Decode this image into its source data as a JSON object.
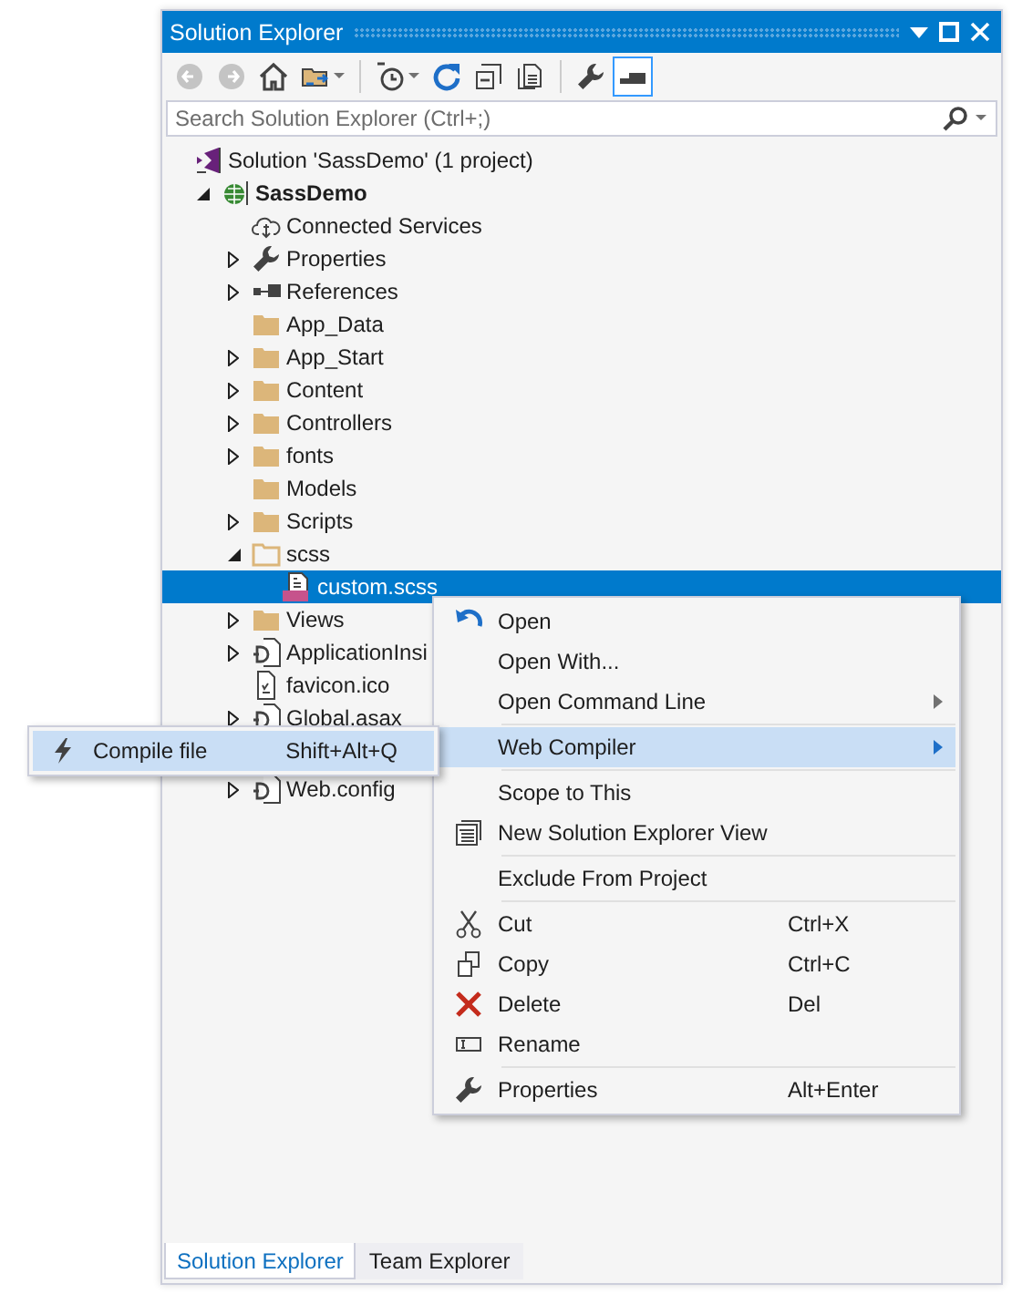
{
  "window": {
    "title": "Solution Explorer"
  },
  "toolbar": [
    {
      "kind": "back",
      "disabled": true,
      "pressed": false,
      "dropdown": false
    },
    {
      "kind": "forward",
      "disabled": true,
      "pressed": false,
      "dropdown": false
    },
    {
      "kind": "home",
      "disabled": false,
      "pressed": false,
      "dropdown": false
    },
    {
      "kind": "sync",
      "disabled": false,
      "pressed": false,
      "dropdown": true
    },
    {
      "kind": "separator"
    },
    {
      "kind": "history",
      "disabled": false,
      "pressed": false,
      "dropdown": true
    },
    {
      "kind": "refresh",
      "disabled": false,
      "pressed": false,
      "dropdown": false
    },
    {
      "kind": "collapse",
      "disabled": false,
      "pressed": false,
      "dropdown": false
    },
    {
      "kind": "allfiles",
      "disabled": false,
      "pressed": false,
      "dropdown": false
    },
    {
      "kind": "separator"
    },
    {
      "kind": "properties",
      "disabled": false,
      "pressed": false,
      "dropdown": false
    },
    {
      "kind": "preview",
      "disabled": false,
      "pressed": true,
      "dropdown": false
    }
  ],
  "search": {
    "placeholder": "Search Solution Explorer (Ctrl+;)"
  },
  "tree": {
    "items": [
      {
        "kind": "solution",
        "label": "Solution 'SassDemo' (1 project)",
        "selected": false,
        "children": [
          {
            "kind": "project",
            "label": "SassDemo",
            "selected": false,
            "expanded": true,
            "children": [
              {
                "kind": "cloud",
                "label": "Connected Services",
                "selected": false
              },
              {
                "kind": "wrench",
                "label": "Properties",
                "selected": false,
                "expanded": false
              },
              {
                "kind": "references",
                "label": "References",
                "selected": false,
                "expanded": false
              },
              {
                "kind": "folder",
                "label": "App_Data",
                "selected": false
              },
              {
                "kind": "folder",
                "label": "App_Start",
                "selected": false,
                "expanded": false
              },
              {
                "kind": "folder",
                "label": "Content",
                "selected": false,
                "expanded": false
              },
              {
                "kind": "folder",
                "label": "Controllers",
                "selected": false,
                "expanded": false
              },
              {
                "kind": "folder",
                "label": "fonts",
                "selected": false,
                "expanded": false
              },
              {
                "kind": "folder",
                "label": "Models",
                "selected": false
              },
              {
                "kind": "folder",
                "label": "Scripts",
                "selected": false,
                "expanded": false
              },
              {
                "kind": "folder-open",
                "label": "scss",
                "selected": false,
                "expanded": true,
                "children": [
                  {
                    "kind": "sass",
                    "label": "custom.scss",
                    "selected": true
                  }
                ]
              },
              {
                "kind": "folder",
                "label": "Views",
                "selected": false,
                "expanded": false
              },
              {
                "kind": "config",
                "label": "ApplicationInsi",
                "selected": false,
                "expanded": false
              },
              {
                "kind": "file",
                "label": "favicon.ico",
                "selected": false
              },
              {
                "kind": "config",
                "label": "Global.asax",
                "selected": false,
                "expanded": false
              },
              {
                "kind": "config",
                "label": "Web.config",
                "selected": false,
                "expanded": false
              }
            ]
          }
        ]
      }
    ]
  },
  "context_menu": {
    "groups": [
      [
        {
          "kind": "open",
          "label": "Open",
          "submenu": false,
          "selected": false
        },
        {
          "kind": "plain",
          "label": "Open With...",
          "submenu": false,
          "selected": false
        },
        {
          "kind": "plain",
          "label": "Open Command Line",
          "submenu": true,
          "selected": false
        }
      ],
      [
        {
          "kind": "plain",
          "label": "Web Compiler",
          "submenu": true,
          "selected": true
        }
      ],
      [
        {
          "kind": "plain",
          "label": "Scope to This",
          "submenu": false,
          "selected": false
        },
        {
          "kind": "newview",
          "label": "New Solution Explorer View",
          "submenu": false,
          "selected": false
        }
      ],
      [
        {
          "kind": "plain",
          "label": "Exclude From Project",
          "submenu": false,
          "selected": false
        }
      ],
      [
        {
          "kind": "cut",
          "label": "Cut",
          "shortcut": "Ctrl+X",
          "submenu": false,
          "selected": false
        },
        {
          "kind": "copy",
          "label": "Copy",
          "shortcut": "Ctrl+C",
          "submenu": false,
          "selected": false
        },
        {
          "kind": "delete",
          "label": "Delete",
          "shortcut": "Del",
          "submenu": false,
          "selected": false
        },
        {
          "kind": "rename",
          "label": "Rename",
          "submenu": false,
          "selected": false
        }
      ],
      [
        {
          "kind": "properties",
          "label": "Properties",
          "shortcut": "Alt+Enter",
          "submenu": false,
          "selected": false
        }
      ]
    ]
  },
  "submenu": {
    "items": [
      {
        "kind": "compile",
        "label": "Compile file",
        "shortcut": "Shift+Alt+Q",
        "selected": true
      }
    ]
  },
  "tabs": [
    {
      "label": "Solution Explorer",
      "selected": true
    },
    {
      "label": "Team Explorer",
      "selected": false
    }
  ]
}
